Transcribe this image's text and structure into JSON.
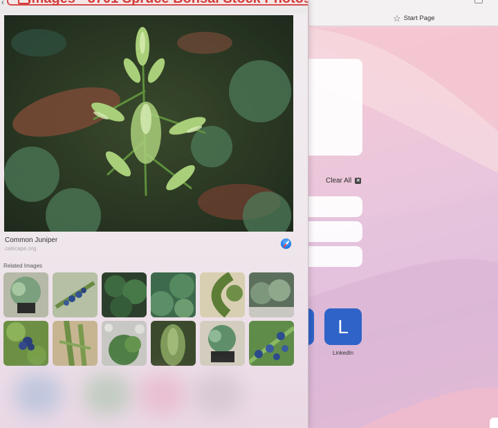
{
  "images_panel": {
    "header_title": "Images - 3701 Spruce Bonsai Stock Photos, F",
    "main_image": {
      "title": "Common Juniper",
      "source": "calscape.org"
    },
    "related_heading": "Related Images",
    "related_images": [
      {
        "name": "juniper-pot-silver"
      },
      {
        "name": "juniper-berries-blue"
      },
      {
        "name": "juniper-dark-shrub"
      },
      {
        "name": "juniper-groundcover"
      },
      {
        "name": "juniper-branch-curve"
      },
      {
        "name": "juniper-spreading"
      },
      {
        "name": "juniper-berry-cluster"
      },
      {
        "name": "juniper-needles-close"
      },
      {
        "name": "juniper-rock-garden"
      },
      {
        "name": "juniper-column"
      },
      {
        "name": "juniper-bonsai-tray"
      },
      {
        "name": "juniper-berries-sprig"
      }
    ]
  },
  "start_page": {
    "tab_label": "Start Page",
    "clear_all_label": "Clear All",
    "favorites": [
      {
        "letter": "L",
        "label": "LinkedIn"
      }
    ]
  },
  "colors": {
    "header_red": "#d43a3a",
    "favorite_blue": "#2f63c8"
  }
}
